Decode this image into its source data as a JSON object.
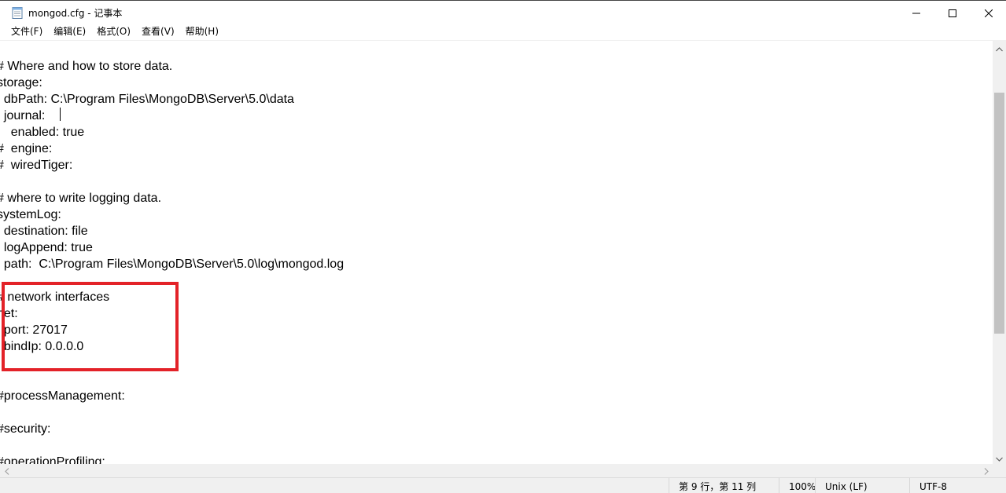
{
  "window": {
    "title": "mongod.cfg - 记事本"
  },
  "menu": {
    "items": [
      "文件(F)",
      "编辑(E)",
      "格式(O)",
      "查看(V)",
      "帮助(H)"
    ]
  },
  "editor": {
    "lines": [
      "",
      "# Where and how to store data.",
      "storage:",
      "  dbPath: C:\\Program Files\\MongoDB\\Server\\5.0\\data",
      "  journal:",
      "    enabled: true",
      "#  engine:",
      "#  wiredTiger:",
      "",
      "# where to write logging data.",
      "systemLog:",
      "  destination: file",
      "  logAppend: true",
      "  path:  C:\\Program Files\\MongoDB\\Server\\5.0\\log\\mongod.log",
      "",
      "# network interfaces",
      "net:",
      "  port: 27017",
      "  bindIp: 0.0.0.0",
      "",
      "",
      "#processManagement:",
      "",
      "#security:",
      "",
      "#operationProfiling:"
    ],
    "highlight_color": "#e32228"
  },
  "statusbar": {
    "position": "第 9 行，第 11 列",
    "zoom": "100%",
    "line_ending": "Unix (LF)",
    "encoding": "UTF-8"
  },
  "icons": {
    "app": "notepad-icon",
    "minimize": "minimize-icon",
    "maximize": "maximize-icon",
    "close": "close-icon"
  }
}
